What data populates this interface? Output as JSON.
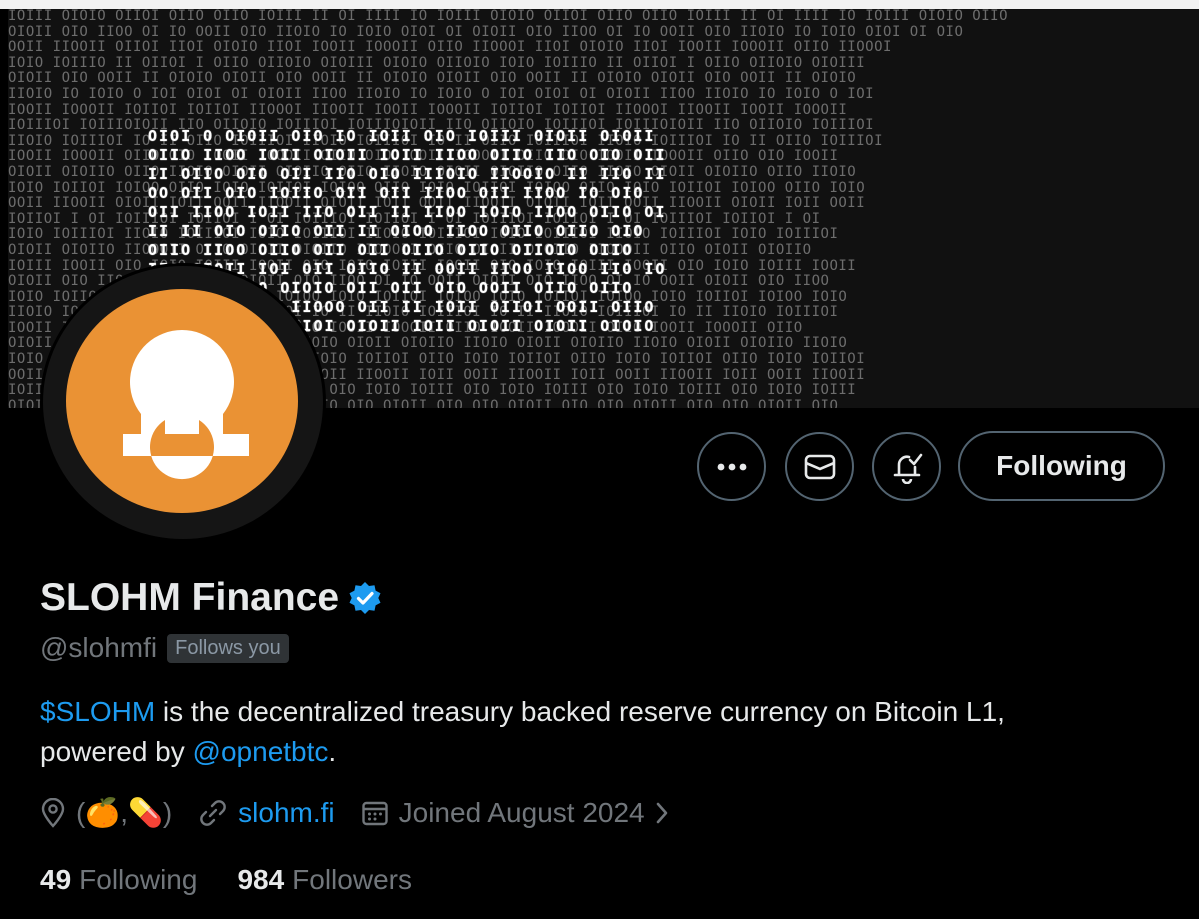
{
  "banner": {
    "pattern_rows": [
      "IOIII OIOIO OIIOI OIIO OIIO IOIII II OI IIII IO IOIII OIOIO OIIOI OIIO OIIO IOIII II OI IIII IO IOIII OIOIO OIIO",
      "OIOII OIO IIOO OI IO OOII OIO IIOIO IO IOIO OIOI OI OIOII OIO IIOO OI IO OOII OIO IIOIO IO IOIO OIOI OI OIO",
      "OOII IIOOII OIIOI IIOI OIOIO IIOI IOOII IOOOII OIIO IIOOOI IIOI OIOIO IIOI IOOII IOOOII OIIO IIOOOI",
      "IOIO IOIIIO II OIIOI I OIIO OIIOIO OIOIII OIOIO OIIOIO IOIO IOIIIO II OIIOI I OIIO OIIOIO OIOIII",
      "OIOII OIO OOII II OIOIO OIOII OIO OOII II OIOIO OIOII OIO OOII II OIOIO OIOII OIO OOII II OIOIO",
      "IIOIO IO IOIO O IOI OIOI OI OIOII IIOO IIOIO IO IOIO O IOI OIOI OI OIOII IIOO IIOIO IO IOIO O IOI",
      "IOOII IOOOII IOIIOI IOIIOI IIOOOI IIOOII IOOII IOOOII IOIIOI IOIIOI IIOOOI IIOOII IOOII IOOOII",
      "IOIIIOI IOIIIOIOII IIO OIIOIO IOIIIOI IOIIIOIOII IIO OIIOIO IOIIIOI IOIIIOIOII IIO OIIOIO IOIIIOI",
      "IIOIO IOIIIOI IO II OIIO IOIIIOI IIOIO IOIIIOI IO II OIIO IOIIIOI IIOIO IOIIIOI IO II OIIO IOIIIOI",
      "IOOII IOOOII OIIO OIO IOOII IOOOII OIIO OIO IOOII IOOOII OIIO OIO IOOII IOOOII OIIO OIO IOOII",
      "OIOII OIOIIO OIIO IIOIO OIOII OIOIIO OIIO IIOIO OIOII OIOIIO OIIO IIOIO OIOII OIOIIO OIIO IIOIO",
      "IOIO IOIIOI IOIOO OIIO IOIO IOIIOI IOIOO OIIO IOIO IOIIOI IOIOO OIIO IOIO IOIIOI IOIOO OIIO IOIO",
      "OOII IIOOII OIOII IOII OOII IIOOII OIOII IOII OOII IIOOII OIOII IOII OOII IIOOII OIOII IOII OOII",
      "IOIIOI I OI IOIIIOI IOIIOI I OI IOIIIOI IOIIOI I OI IOIIIOI IOIIOI I OI IOIIIOI IOIIOI I OI",
      "IOIO IOIIIOI IIOIO IOIIIOI IOIO IOIIIOI IIOIO IOIIIOI IOIO IOIIIOI IIOIO IOIIIOI IOIO IOIIIOI",
      "OIOII OIOIIO IIOOOII OIIO OIOII OIOIIO IIOOOII OIIO OIOII OIOIIO IIOOOII OIIO OIOII OIOIIO",
      "IOIII IOOII OIO IOIO IOIII IOOII OIO IOIO IOIII IOOII OIO IOIO IOIII IOOII OIO IOIO IOIII IOOII",
      "OIOII OIO IIOO OI IO OOII OIOII OIO IIOO OI IO OOII OIOII OIO IIOO OI IO OOII OIOII OIO IIOO",
      "IOIO IOIIOI IOIOO IOIO IOIIOI IOIOO IOIO IOIIOI IOIOO IOIO IOIIOI IOIOO IOIO IOIIOI IOIOO IOIO",
      "IIOIO IOIIIOI IO II IIOIO IOIIIOI IO II IIOIO IOIIIOI IO II IIOIO IOIIIOI IO II IIOIO IOIIIOI",
      "IOOII IOOOII OIIO IOOII IOOOII OIIO IOOII IOOOII OIIO IOOII IOOOII OIIO IOOII IOOOII OIIO",
      "OIOII OIOIIO IIOIO OIOII OIOIIO IIOIO OIOII OIOIIO IIOIO OIOII OIOIIO IIOIO OIOII OIOIIO IIOIO",
      "IOIO IOIIOI OIIO IOIO IOIIOI OIIO IOIO IOIIOI OIIO IOIO IOIIOI OIIO IOIO IOIIOI OIIO IOIO IOIIOI",
      "OOII IIOOII IOII OOII IIOOII IOII OOII IIOOII IOII OOII IIOOII IOII OOII IIOOII IOII OOII IIOOII",
      "IOIII OIO IOIO IOIII OIO IOIO IOIII OIO IOIO IOIII OIO IOIO IOIII OIO IOIO IOIII OIO IOIO IOIII",
      "OIOII OIO OIO OIOII OIO OIO OIOII OIO OIO OIOII OIO OIO OIOII OIO OIO OIOII OIO OIO OIOII OIO"
    ],
    "logo_rows": [
      "OIOI O OIOII OIO IO IOII OIO IOIII OIOII OIOII",
      "OIIO IIOO IOII OIOII IOII IIOO OIIO IIO OIO OII",
      "II OIIO OIO OII IIO OIO IIIOIO IIOOIO II IIO II",
      "OO OII OIO IOIIO OII OII IIOO OII IIOO IO OIO",
      "OII IIOO IOII IIO OII II IIOO IOIO IIOO OIIO OI",
      "II II OIO OIIO OII II OIOO IIOO OIIO OIIO OIO",
      "OIIO IIOO OIIO OII OII OIIO OIIO OIIOIO OIIO",
      "IIO OIOII IOI OII OIIO II OOII IIOO IIOO IIO IO",
      "IIOIO IOIIO OIOIO OII OII OIO OOII OIIO OIIO",
      "IIOOOII IIOI IIOOO OII II IOII OIIOI OOII OIIO",
      "OIIOI OIOII OIIOI OIOII IOII OIOII OIOII OIOIO"
    ]
  },
  "actions": {
    "more_label": "More",
    "message_label": "Message",
    "notify_label": "Notifications",
    "follow_label": "Following"
  },
  "profile": {
    "display_name": "SLOHM Finance",
    "handle": "@slohmfi",
    "follows_you": "Follows you",
    "bio_link_ticker": "$SLOHM",
    "bio_text_1": " is the decentralized treasury backed reserve currency on Bitcoin L1,",
    "bio_text_2": "powered by ",
    "bio_link_mention": "@opnetbtc",
    "bio_text_3": ".",
    "location": "(🍊,💊)",
    "website": "slohm.fi",
    "joined": "Joined August 2024",
    "following_count": "49",
    "following_label": "Following",
    "followers_count": "984",
    "followers_label": "Followers"
  },
  "colors": {
    "accent": "#1d9bf0",
    "avatar_bg": "#ea9234",
    "verified": "#1d9bf0"
  }
}
